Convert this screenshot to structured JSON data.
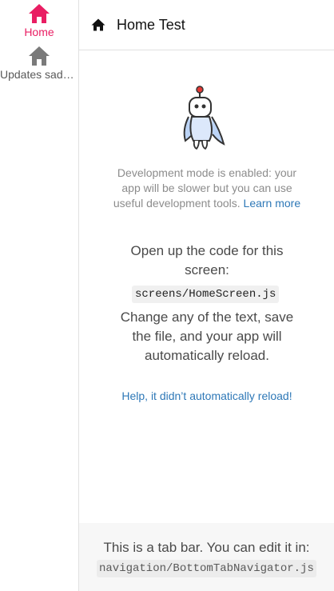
{
  "sidebar": {
    "items": [
      {
        "label": "Home",
        "icon": "home-icon",
        "active": true,
        "color": "#e91e63"
      },
      {
        "label": "Updates sadasd",
        "icon": "home-icon",
        "active": false,
        "color": "#595959"
      }
    ]
  },
  "header": {
    "icon": "home-icon",
    "title": "Home Test"
  },
  "main": {
    "dev_notice_text": "Development mode is enabled: your app will be slower but you can use useful development tools.",
    "learn_more": "Learn more",
    "open_code": "Open up the code for this screen:",
    "code_path": "screens/HomeScreen.js",
    "change_text": "Change any of the text, save the file, and your app will automatically reload.",
    "help_link": "Help, it didn’t automatically reload!"
  },
  "tabbar_info": {
    "message": "This is a tab bar. You can edit it in:",
    "path": "navigation/BottomTabNavigator.js"
  },
  "colors": {
    "accent": "#e91e63",
    "link": "#2e78b7",
    "inactive": "#595959"
  }
}
